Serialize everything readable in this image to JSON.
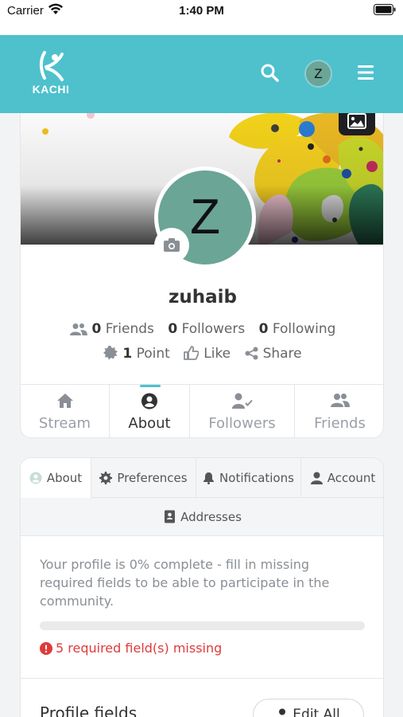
{
  "status_bar": {
    "carrier": "Carrier",
    "time": "1:40 PM"
  },
  "app_bar": {
    "logo_text": "KACHI",
    "avatar_initial": "Z"
  },
  "profile": {
    "avatar_initial": "Z",
    "username": "zuhaib",
    "friends_count": "0",
    "friends_label": "Friends",
    "followers_count": "0",
    "followers_label": "Followers",
    "following_count": "0",
    "following_label": "Following",
    "points_count": "1",
    "points_label": "Point",
    "like_label": "Like",
    "share_label": "Share"
  },
  "profile_tabs": [
    {
      "label": "Stream",
      "icon": "home-icon"
    },
    {
      "label": "About",
      "icon": "user-circle-icon"
    },
    {
      "label": "Followers",
      "icon": "user-check-icon"
    },
    {
      "label": "Friends",
      "icon": "users-icon"
    }
  ],
  "settings_tabs": [
    {
      "label": "About",
      "icon": "user-circle-icon"
    },
    {
      "label": "Preferences",
      "icon": "gear-icon"
    },
    {
      "label": "Notifications",
      "icon": "bell-icon"
    },
    {
      "label": "Account",
      "icon": "user-icon"
    }
  ],
  "settings_tab_row2": {
    "label": "Addresses",
    "icon": "address-book-icon"
  },
  "completion": {
    "text": "Your profile is 0% complete - fill in missing required fields to be able to participate in the community.",
    "percent": 0,
    "missing_text": "5 required field(s) missing"
  },
  "profile_fields": {
    "title": "Profile fields",
    "edit_all_label": "Edit All"
  },
  "colors": {
    "accent": "#4ec1cd",
    "avatar": "#6aa596",
    "error": "#e03a3a"
  }
}
